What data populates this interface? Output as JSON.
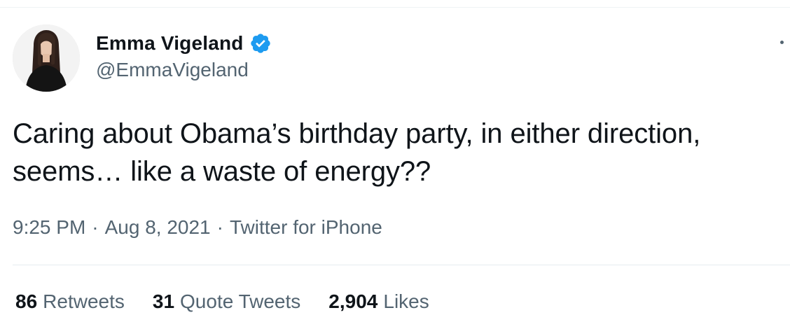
{
  "author": {
    "display_name": "Emma Vigeland",
    "handle": "@EmmaVigeland",
    "verified": true,
    "avatar_icon": "profile-photo",
    "verified_icon": "verified-badge-icon",
    "verified_color": "#1d9bf0"
  },
  "tweet": {
    "text": "Caring about Obama’s birthday party, in either direction, seems… like a waste of energy??"
  },
  "meta": {
    "time": "9:25 PM",
    "separator": "·",
    "date": "Aug 8, 2021",
    "source": "Twitter for iPhone"
  },
  "stats": [
    {
      "count": "86",
      "label": "Retweets"
    },
    {
      "count": "31",
      "label": "Quote Tweets"
    },
    {
      "count": "2,904",
      "label": "Likes"
    }
  ],
  "colors": {
    "text": "#0f1419",
    "secondary": "#536471",
    "divider": "#eff3f4"
  }
}
